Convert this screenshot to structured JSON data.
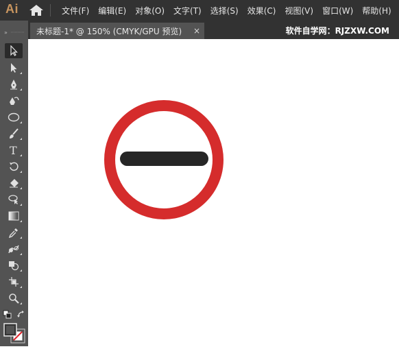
{
  "app": {
    "logo": "Ai"
  },
  "menu": {
    "items": [
      "文件(F)",
      "编辑(E)",
      "对象(O)",
      "文字(T)",
      "选择(S)",
      "效果(C)",
      "视图(V)",
      "窗口(W)",
      "帮助(H)"
    ]
  },
  "document": {
    "tab_title": "未标题-1* @ 150% (CMYK/GPU 预览)",
    "close_glyph": "×"
  },
  "watermark": "软件自学网：RJZXW.COM",
  "toolbar": {
    "tools": [
      "selection-tool",
      "direct-selection-tool",
      "pen-tool",
      "curvature-tool",
      "ellipse-tool",
      "paintbrush-tool",
      "type-tool",
      "rotate-tool",
      "eraser-tool",
      "lasso-tool",
      "gradient-tool",
      "eyedropper-tool",
      "blend-tool",
      "shape-builder-tool",
      "artboard-tool",
      "zoom-tool"
    ],
    "selected": "selection-tool"
  },
  "artwork": {
    "ring_color": "#d52c2c",
    "bar_color": "#262626"
  }
}
